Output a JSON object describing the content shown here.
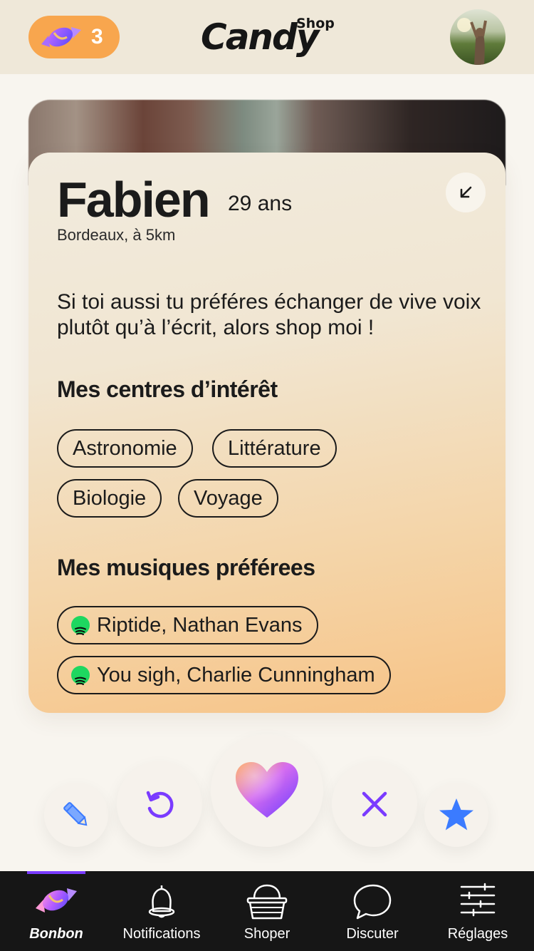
{
  "header": {
    "candy_count": "3",
    "logo_main": "Candy",
    "logo_sub": "Shop"
  },
  "profile": {
    "name": "Fabien",
    "age": "29 ans",
    "location": "Bordeaux, à 5km",
    "bio": "Si toi aussi tu préféres échanger de vive voix plutôt qu’à l’écrit, alors shop moi !",
    "interests_title": "Mes centres d’intérêt",
    "interests": [
      "Astronomie",
      "Littérature",
      "Biologie",
      "Voyage"
    ],
    "music_title": "Mes musiques préférees",
    "music": [
      "Riptide, Nathan Evans",
      "You sigh, Charlie Cunningham"
    ]
  },
  "actions": [
    "edit-icon",
    "undo-icon",
    "heart-icon",
    "close-icon",
    "star-icon"
  ],
  "nav": {
    "items": [
      {
        "label": "Bonbon",
        "icon": "candy-icon",
        "active": true
      },
      {
        "label": "Notifications",
        "icon": "bell-icon"
      },
      {
        "label": "Shoper",
        "icon": "basket-icon"
      },
      {
        "label": "Discuter",
        "icon": "chat-icon"
      },
      {
        "label": "Réglages",
        "icon": "sliders-icon"
      }
    ]
  },
  "colors": {
    "accent": "#7a3bff",
    "badge": "#f8a64e",
    "star": "#3b7bff",
    "spotify": "#1ed760"
  }
}
